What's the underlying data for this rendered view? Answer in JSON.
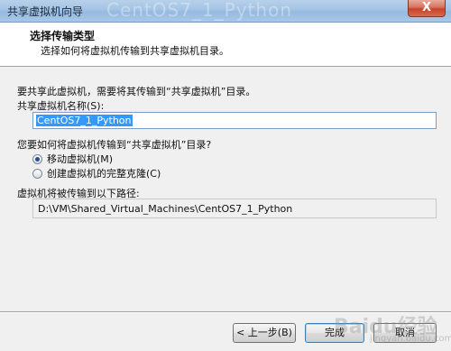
{
  "window": {
    "title": "共享虚拟机向导",
    "title_ghost": "CentOS7_1_Python",
    "close_label": "X"
  },
  "header": {
    "title": "选择传输类型",
    "subtitle": "选择如何将虚拟机传输到共享虚拟机目录。"
  },
  "form": {
    "intro": "要共享此虚拟机，需要将其传输到“共享虚拟机”目录。",
    "name_label": "共享虚拟机名称(S):",
    "name_value": "CentOS7_1_Python",
    "transfer_question": "您要如何将虚拟机传输到“共享虚拟机”目录?",
    "options": [
      {
        "label": "移动虚拟机(M)",
        "checked": true
      },
      {
        "label": "创建虚拟机的完整克隆(C)",
        "checked": false
      }
    ],
    "path_label": "虚拟机将被传输到以下路径:",
    "path_value": "D:\\VM\\Shared_Virtual_Machines\\CentOS7_1_Python"
  },
  "buttons": {
    "back": "< 上一步(B)",
    "finish": "完成",
    "cancel": "取消"
  },
  "watermark": {
    "text": "Baidu经验",
    "sub": "jingyan.baidu.com"
  }
}
